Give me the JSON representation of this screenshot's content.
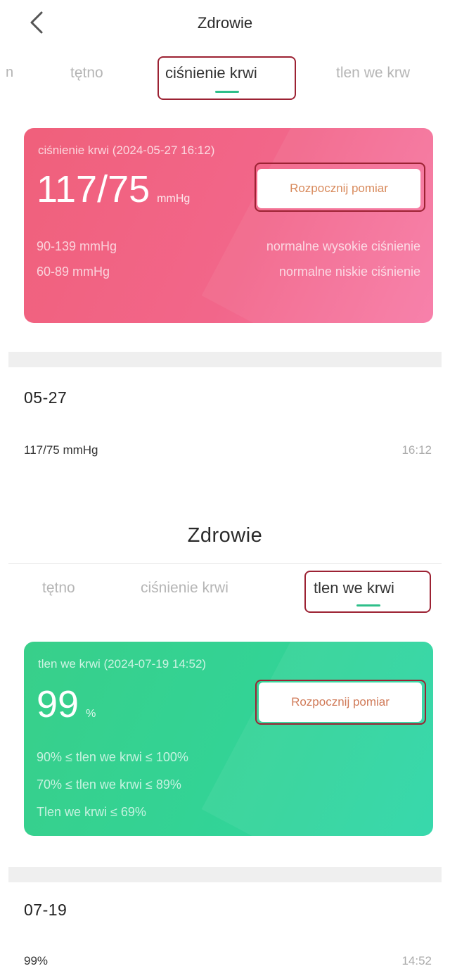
{
  "screen_bp": {
    "title": "Zdrowie",
    "tabs": [
      {
        "label": "n"
      },
      {
        "label": "tętno"
      },
      {
        "label": "ciśnienie krwi"
      },
      {
        "label": "tlen we krw"
      }
    ],
    "card": {
      "label": "ciśnienie krwi  (2024-05-27 16:12)",
      "value": "117/75",
      "unit": "mmHg",
      "button": "Rozpocznij pomiar",
      "ranges": [
        {
          "range": "90-139 mmHg",
          "desc": "normalne wysokie ciśnienie"
        },
        {
          "range": "60-89 mmHg",
          "desc": "normalne niskie ciśnienie"
        }
      ]
    },
    "history": {
      "date": "05-27",
      "records": [
        {
          "value": "117/75 mmHg",
          "time": "16:12"
        }
      ]
    }
  },
  "screen_o2": {
    "title": "Zdrowie",
    "tabs": [
      {
        "label": "tętno"
      },
      {
        "label": "ciśnienie krwi"
      },
      {
        "label": "tlen we krwi"
      }
    ],
    "card": {
      "label": "tlen we krwi  (2024-07-19 14:52)",
      "value": "99",
      "unit": "%",
      "button": "Rozpocznij pomiar",
      "ranges": [
        {
          "range": "90% ≤ tlen we krwi ≤ 100%"
        },
        {
          "range": "70% ≤ tlen we krwi ≤ 89%"
        },
        {
          "range": "Tlen we krwi ≤ 69%"
        }
      ]
    },
    "history": {
      "date": "07-19",
      "records": [
        {
          "value": "99%",
          "time": "14:52"
        }
      ]
    }
  },
  "colors": {
    "bp_card": "#f2668a",
    "o2_card": "#33d395",
    "tab_underline": "#2fbf8a",
    "highlight_border": "#9c2233"
  },
  "icons": {
    "back": "chevron-left-icon"
  }
}
